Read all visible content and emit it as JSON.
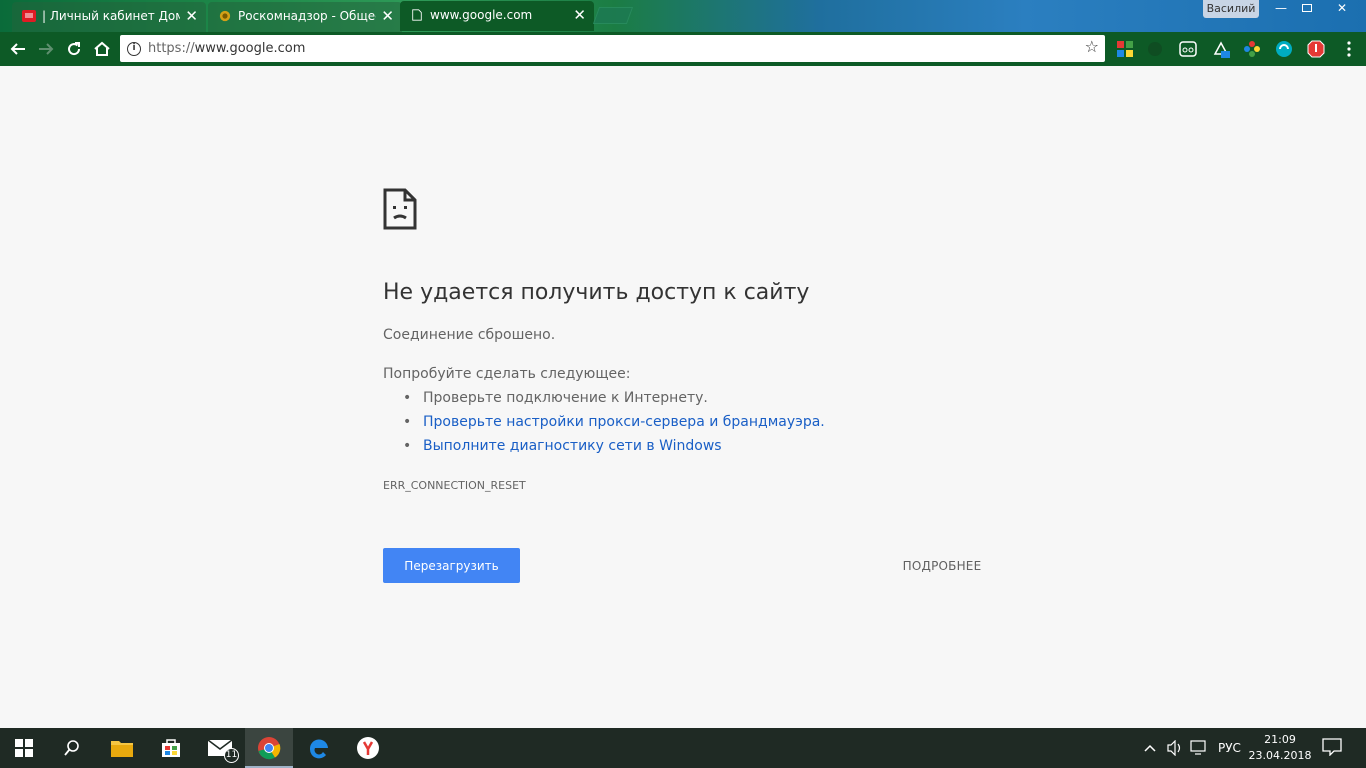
{
  "window": {
    "tabs": [
      {
        "title": "| Личный кабинет Дом",
        "icon": "red-flag-icon"
      },
      {
        "title": "Роскомнадзор - Общес",
        "icon": "emblem-icon"
      },
      {
        "title": "www.google.com",
        "icon": "page-icon"
      }
    ],
    "user_name": "Василий",
    "minimize": "—",
    "close": "✕"
  },
  "toolbar": {
    "url_scheme": "https://",
    "url_host": "www.google.com"
  },
  "error_page": {
    "heading": "Не удается получить доступ к сайту",
    "subtitle": "Соединение сброшено.",
    "suggest_title": "Попробуйте сделать следующее:",
    "suggestions": [
      "Проверьте подключение к Интернету.",
      "Проверьте настройки прокси-сервера и брандмауэра.",
      "Выполните диагностику сети в Windows"
    ],
    "error_code": "ERR_CONNECTION_RESET",
    "reload_label": "Перезагрузить",
    "details_label": "ПОДРОБНЕЕ"
  },
  "taskbar": {
    "mail_badge": "11",
    "language": "РУС",
    "time": "21:09",
    "date": "23.04.2018"
  },
  "colors": {
    "accent_button": "#4285f4",
    "link": "#1a5fc6",
    "toolbar": "#0d5a26"
  }
}
